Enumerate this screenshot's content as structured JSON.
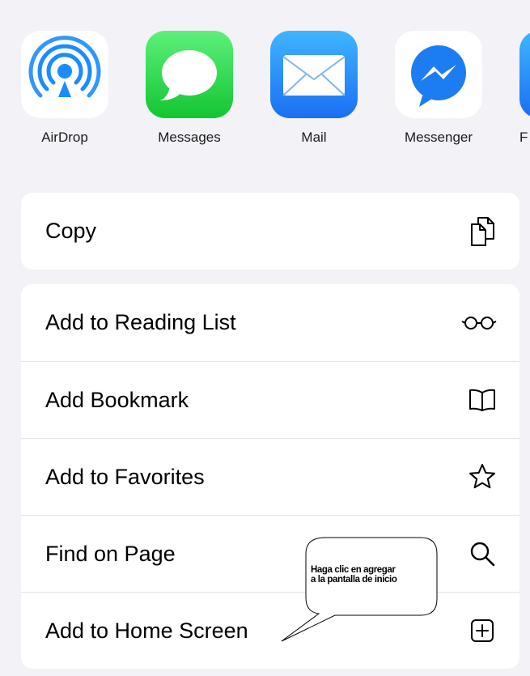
{
  "share_apps": [
    {
      "label": "AirDrop",
      "icon": "airdrop-icon"
    },
    {
      "label": "Messages",
      "icon": "messages-icon"
    },
    {
      "label": "Mail",
      "icon": "mail-icon"
    },
    {
      "label": "Messenger",
      "icon": "messenger-icon"
    },
    {
      "label": "F",
      "icon": "app-icon"
    }
  ],
  "copy_group": {
    "copy_label": "Copy",
    "copy_icon": "copy-icon"
  },
  "actions": [
    {
      "label": "Add to Reading List",
      "icon": "glasses-icon"
    },
    {
      "label": "Add Bookmark",
      "icon": "book-icon"
    },
    {
      "label": "Add to Favorites",
      "icon": "star-icon"
    },
    {
      "label": "Find on Page",
      "icon": "magnifier-icon"
    },
    {
      "label": "Add to Home Screen",
      "icon": "plus-square-icon"
    }
  ],
  "callout": {
    "line1": "Haga clic en agregar",
    "line2": "a la pantalla de inicio"
  }
}
